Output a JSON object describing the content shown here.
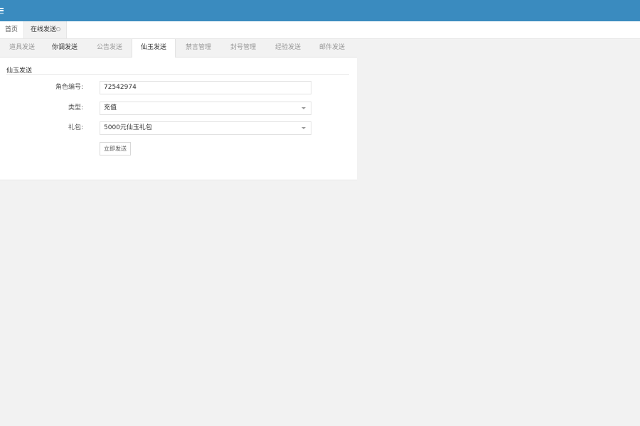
{
  "page_tabs": {
    "home": "首页",
    "active": "在线发送"
  },
  "sub_tabs": [
    {
      "label": "道具发送"
    },
    {
      "label": "你调发送"
    },
    {
      "label": "公告发送"
    },
    {
      "label": "仙玉发送"
    },
    {
      "label": "禁言管理"
    },
    {
      "label": "封号管理"
    },
    {
      "label": "经验发送"
    },
    {
      "label": "邮件发送"
    }
  ],
  "active_sub_tab": "仙玉发送",
  "form": {
    "section_title": "仙玉发送",
    "role_id_label": "角色编号:",
    "role_id_value": "72542974",
    "type_label": "类型:",
    "type_value": "充值",
    "package_label": "礼包:",
    "package_value": "5000元仙玉礼包",
    "submit_label": "立即发送"
  },
  "colors": {
    "topbar": "#3a8bbf",
    "background": "#f2f2f2"
  }
}
